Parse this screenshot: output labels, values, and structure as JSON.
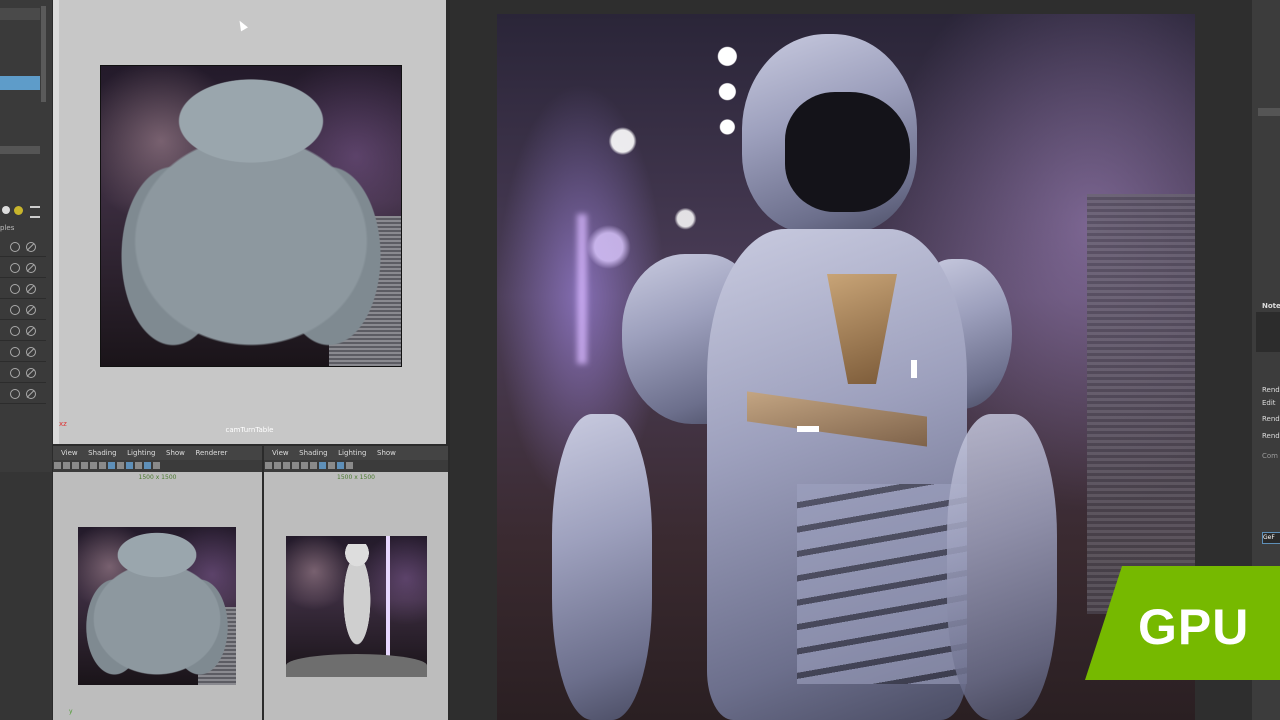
{
  "viewport_top": {
    "camera_label": "camTurnTable",
    "axis_label": "xz"
  },
  "left_panel": {
    "section_label": "ples",
    "rows": 8
  },
  "panel_left": {
    "menu": [
      "View",
      "Shading",
      "Lighting",
      "Show",
      "Renderer"
    ],
    "resolution": "1500 x 1500",
    "axis_label": "y"
  },
  "panel_right": {
    "menu": [
      "View",
      "Shading",
      "Lighting",
      "Show"
    ],
    "resolution": "1500 x 1500"
  },
  "right_panel": {
    "labels": [
      "Note",
      "Rend",
      "Edit",
      "Rend",
      "Rend",
      "Com",
      "GeF"
    ]
  },
  "badge": {
    "text": "GPU",
    "color": "#76b900"
  }
}
